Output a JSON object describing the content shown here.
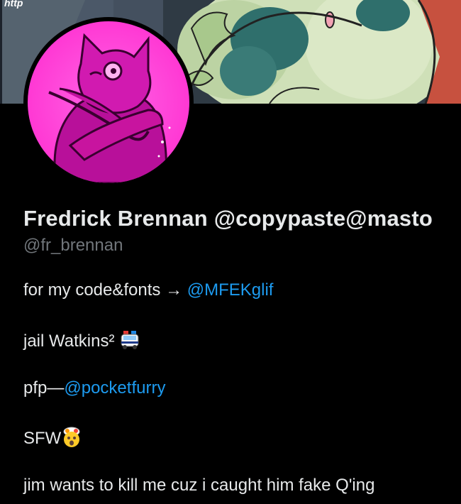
{
  "banner": {
    "corner_text": "http"
  },
  "profile": {
    "display_name": "Fredrick Brennan @copypaste@masto",
    "handle": "@fr_brennan"
  },
  "bio": {
    "line1_text": "for my code&fonts → ",
    "line1_link": "@MFEKglif",
    "line2_text": "jail Watkins²",
    "line2_emoji": "police-car-emoji",
    "line3_text": "pfp—",
    "line3_link": "@pocketfurry",
    "line4_text": "SFW",
    "line4_emoji": "exploding-head-emoji",
    "line5_text": "jim wants to kill me cuz i caught him fake Q'ing"
  },
  "colors": {
    "background": "#000000",
    "text": "#e7e9ea",
    "muted": "#71767b",
    "link": "#1d9bf0",
    "avatar_pink": "#ff3cd6"
  }
}
